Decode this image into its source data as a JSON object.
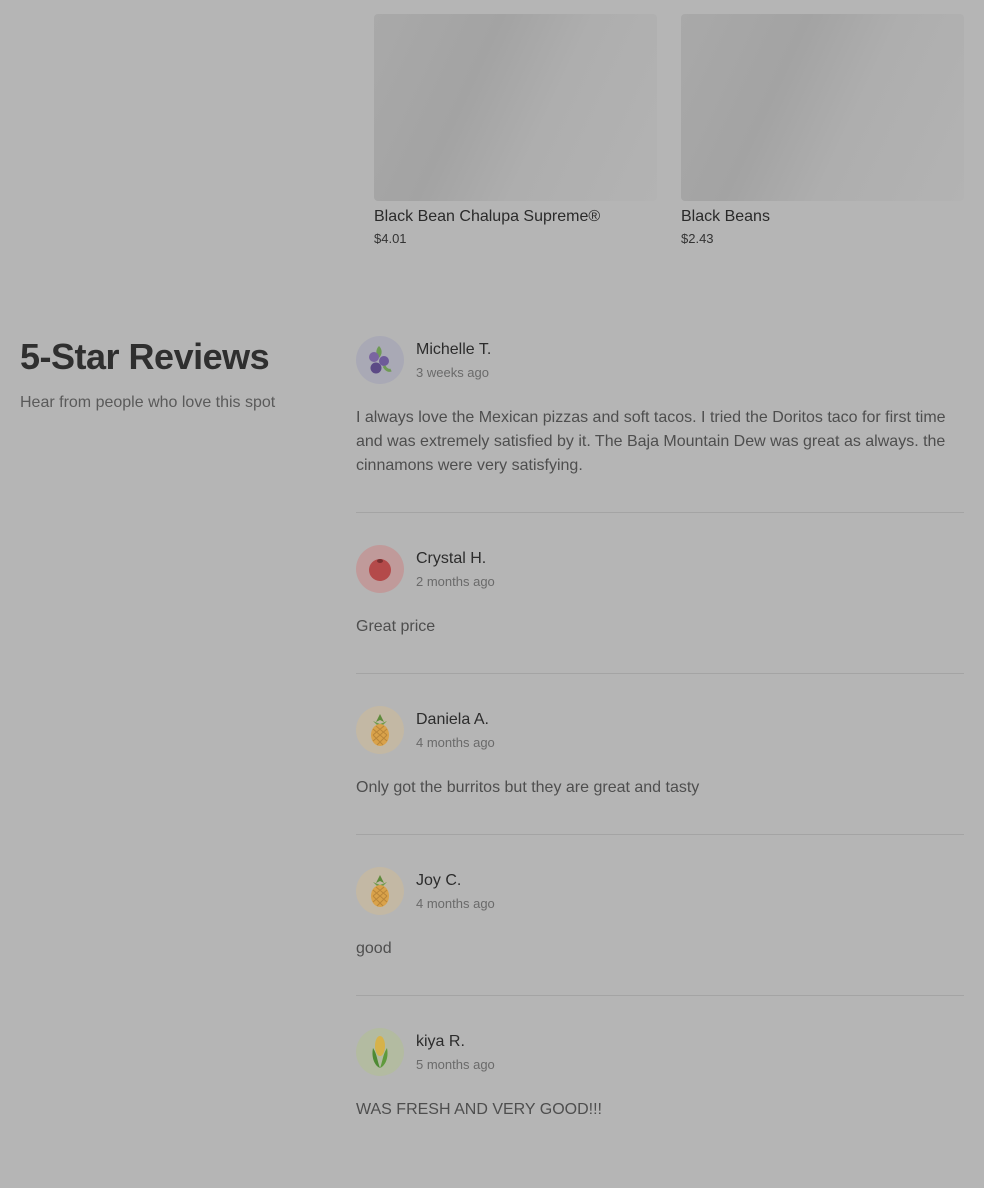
{
  "products": [
    {
      "name": "Black Bean Chalupa Supreme®",
      "price": "$4.01"
    },
    {
      "name": "Black Beans",
      "price": "$2.43"
    }
  ],
  "reviews_section": {
    "title": "5-Star Reviews",
    "subtitle": "Hear from people who love this spot"
  },
  "reviews": [
    {
      "name": "Michelle T.",
      "date": "3 weeks ago",
      "avatar": "blueberries-icon",
      "text": "I always love the Mexican pizzas and soft tacos. I tried the Doritos taco for first time and was extremely satisfied by it. The Baja Mountain Dew was great as always. the cinnamons were very satisfying."
    },
    {
      "name": "Crystal H.",
      "date": "2 months ago",
      "avatar": "tomato-icon",
      "text": "Great price"
    },
    {
      "name": "Daniela A.",
      "date": "4 months ago",
      "avatar": "pineapple-icon",
      "text": "Only got the burritos but they are great and tasty"
    },
    {
      "name": "Joy C.",
      "date": "4 months ago",
      "avatar": "pineapple-icon",
      "text": "good"
    },
    {
      "name": "kiya R.",
      "date": "5 months ago",
      "avatar": "corn-icon",
      "text": "WAS FRESH AND VERY GOOD!!!"
    }
  ],
  "colors": {
    "overlay_background": "#b5b5b5",
    "avatar_blueberry_bg": "#a9a9b5",
    "avatar_tomato_bg": "#c09a9a",
    "avatar_pineapple_bg": "#c3b8a4",
    "avatar_corn_bg": "#b3bba1"
  }
}
